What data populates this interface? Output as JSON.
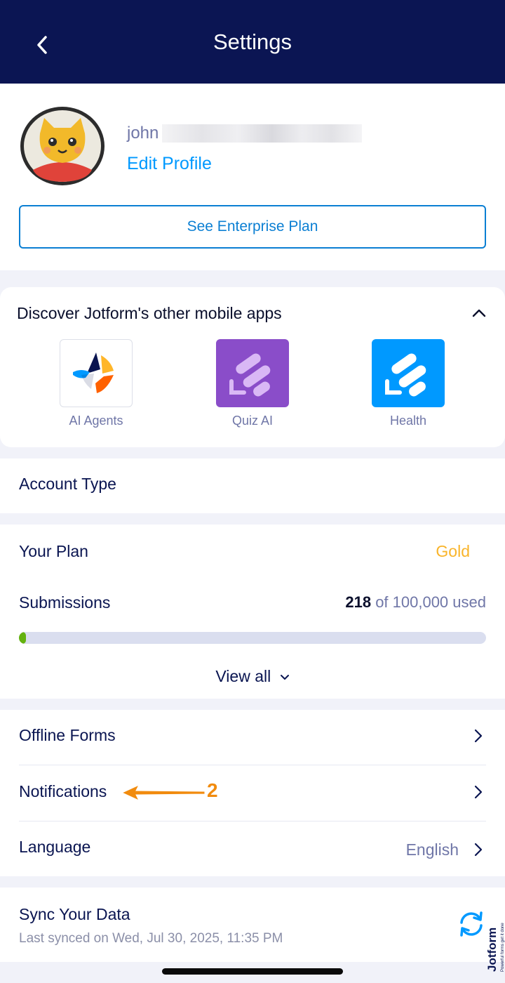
{
  "header": {
    "title": "Settings"
  },
  "profile": {
    "username": "john",
    "edit_label": "Edit Profile",
    "enterprise_label": "See Enterprise Plan"
  },
  "discover": {
    "title": "Discover Jotform's other mobile apps",
    "apps": [
      {
        "label": "AI Agents",
        "icon": "ai-agents-icon"
      },
      {
        "label": "Quiz AI",
        "icon": "quiz-ai-icon",
        "color": "#8a4dc9"
      },
      {
        "label": "Health",
        "icon": "health-icon",
        "color": "#0099ff"
      }
    ]
  },
  "account_type": {
    "label": "Account Type"
  },
  "plan": {
    "label": "Your Plan",
    "value": "Gold",
    "value_color": "#f9b42a",
    "submissions_label": "Submissions",
    "submissions_used": "218",
    "submissions_rest": "of 100,000 used",
    "progress_fraction": 0.00218,
    "view_all_label": "View all"
  },
  "list": {
    "offline_forms": "Offline Forms",
    "notifications": "Notifications",
    "language": "Language",
    "language_value": "English"
  },
  "annotation": {
    "step": "2"
  },
  "sync": {
    "title": "Sync Your Data",
    "subtitle": "Last synced on Wed, Jul 30, 2025, 11:35 PM"
  },
  "brand": {
    "name": "Jotform",
    "tagline": "Powerful forms get it done"
  }
}
